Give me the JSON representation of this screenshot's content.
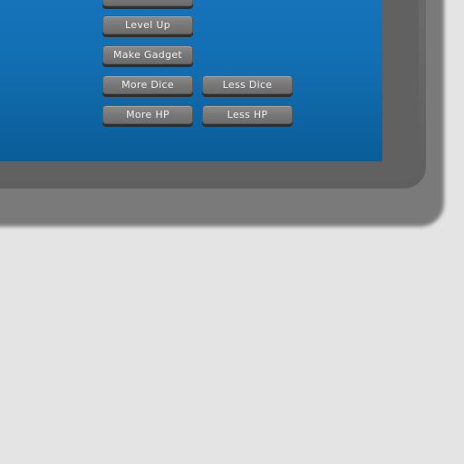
{
  "buttons": {
    "partial_top": "",
    "level_up": "Level Up",
    "make_gadget": "Make Gadget",
    "more_dice": "More Dice",
    "less_dice": "Less Dice",
    "more_hp": "More HP",
    "less_hp": "Less HP"
  },
  "colors": {
    "background": "#e4e4e4",
    "panel_blue_top": "#1a78c2",
    "panel_blue_bottom": "#0a5d98",
    "frame_grey": "#616161",
    "button_grey": "#787878",
    "button_text": "#f0f0f0"
  }
}
